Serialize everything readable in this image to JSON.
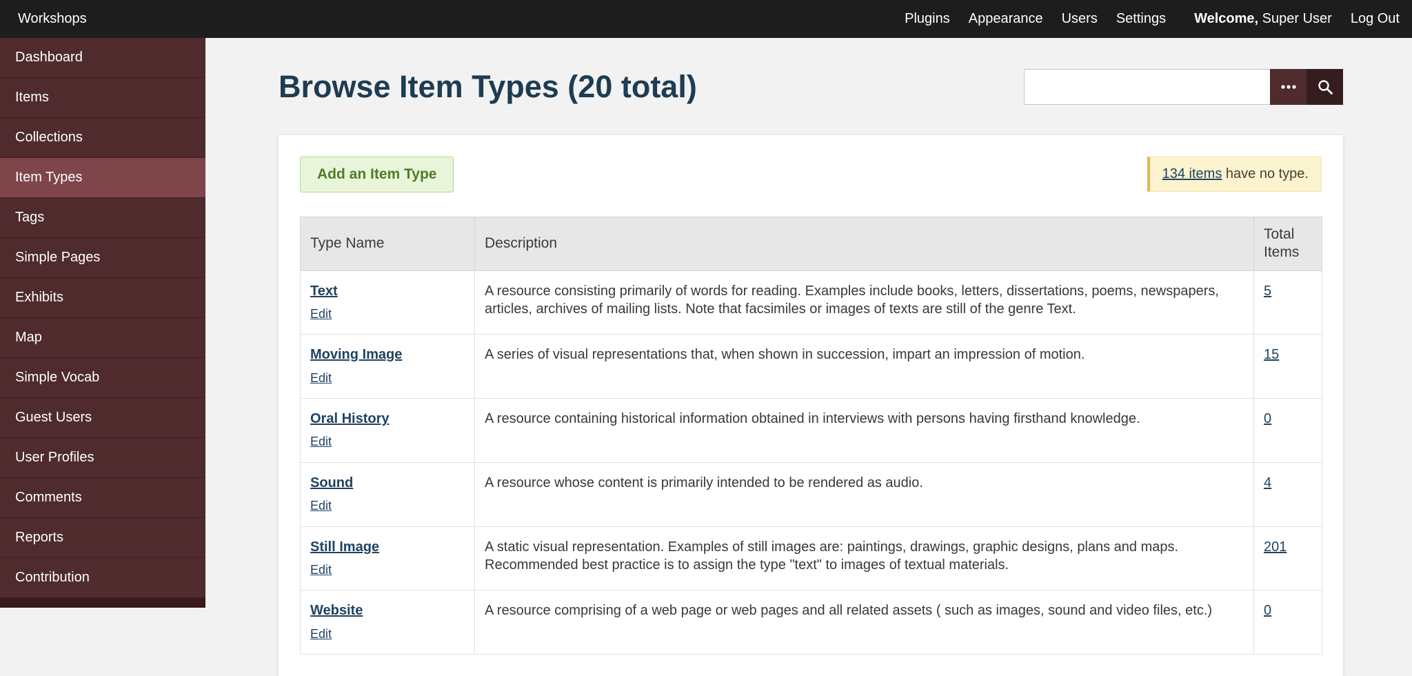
{
  "topbar": {
    "site_title": "Workshops",
    "nav_items": [
      "Plugins",
      "Appearance",
      "Users",
      "Settings"
    ],
    "welcome_bold": "Welcome,",
    "welcome_rest": " Super User",
    "logout": "Log Out"
  },
  "sidebar": {
    "items": [
      {
        "label": "Dashboard",
        "active": false
      },
      {
        "label": "Items",
        "active": false
      },
      {
        "label": "Collections",
        "active": false
      },
      {
        "label": "Item Types",
        "active": true
      },
      {
        "label": "Tags",
        "active": false
      },
      {
        "label": "Simple Pages",
        "active": false
      },
      {
        "label": "Exhibits",
        "active": false
      },
      {
        "label": "Map",
        "active": false
      },
      {
        "label": "Simple Vocab",
        "active": false
      },
      {
        "label": "Guest Users",
        "active": false
      },
      {
        "label": "User Profiles",
        "active": false
      },
      {
        "label": "Comments",
        "active": false
      },
      {
        "label": "Reports",
        "active": false
      },
      {
        "label": "Contribution",
        "active": false
      }
    ]
  },
  "main": {
    "page_title": "Browse Item Types (20 total)",
    "search": {
      "value": ""
    },
    "add_button": "Add an Item Type",
    "notice": {
      "link": "134 items",
      "rest": " have no type."
    },
    "table": {
      "headers": {
        "name": "Type Name",
        "description": "Description",
        "total": "Total Items"
      },
      "rows": [
        {
          "name": "Text",
          "edit": "Edit",
          "description": "A resource consisting primarily of words for reading. Examples include books, letters, dissertations, poems, newspapers, articles, archives of mailing lists. Note that facsimiles or images of texts are still of the genre Text.",
          "total": "5"
        },
        {
          "name": "Moving Image",
          "edit": "Edit",
          "description": "A series of visual representations that, when shown in succession, impart an impression of motion.",
          "total": "15"
        },
        {
          "name": "Oral History",
          "edit": "Edit",
          "description": "A resource containing historical information obtained in interviews with persons having firsthand knowledge.",
          "total": "0"
        },
        {
          "name": "Sound",
          "edit": "Edit",
          "description": "A resource whose content is primarily intended to be rendered as audio.",
          "total": "4"
        },
        {
          "name": "Still Image",
          "edit": "Edit",
          "description": "A static visual representation. Examples of still images are: paintings, drawings, graphic designs, plans and maps. Recommended best practice is to assign the type \"text\" to images of textual materials.",
          "total": "201"
        },
        {
          "name": "Website",
          "edit": "Edit",
          "description": "A resource comprising of a web page or web pages and all related assets ( such as images, sound and video files, etc.)",
          "total": "0"
        }
      ]
    }
  },
  "colors": {
    "topbar_bg": "#1d1d1d",
    "sidebar_item_bg": "#4f2b2d",
    "sidebar_active_bg": "#7e454b",
    "heading_link": "#1e3c52",
    "add_button_bg": "#e9f5da",
    "add_button_text": "#4d7d25",
    "notice_bg": "#fcf3cf",
    "table_header_bg": "#e7e7e7"
  }
}
